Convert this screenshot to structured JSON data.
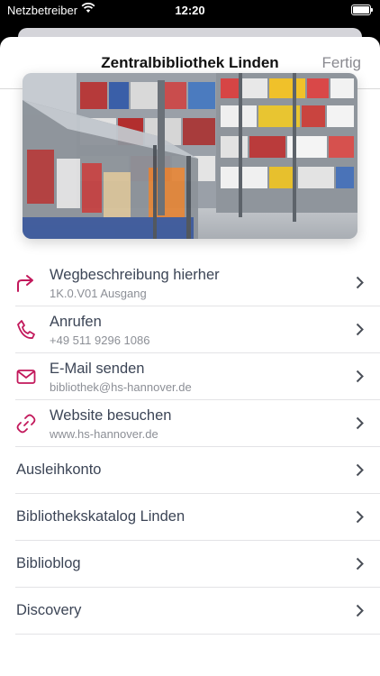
{
  "status_bar": {
    "carrier": "Netzbetreiber",
    "time": "12:20"
  },
  "navbar": {
    "title": "Zentralbibliothek Linden",
    "done_label": "Fertig"
  },
  "actions": [
    {
      "label": "Wegbeschreibung hierher",
      "detail": "1K.0.V01 Ausgang",
      "icon": "directions-arrow-icon"
    },
    {
      "label": "Anrufen",
      "detail": "+49 511 9296 1086",
      "icon": "phone-icon"
    },
    {
      "label": "E-Mail senden",
      "detail": "bibliothek@hs-hannover.de",
      "icon": "mail-icon"
    },
    {
      "label": "Website besuchen",
      "detail": "www.hs-hannover.de",
      "icon": "link-icon"
    }
  ],
  "links": [
    {
      "label": "Ausleihkonto"
    },
    {
      "label": "Bibliothekskatalog Linden"
    },
    {
      "label": "Biblioblog"
    },
    {
      "label": "Discovery"
    }
  ],
  "colors": {
    "accent": "#c2185b",
    "text": "#3c4556",
    "detail": "#8c8f96",
    "done": "#8a8a90"
  }
}
